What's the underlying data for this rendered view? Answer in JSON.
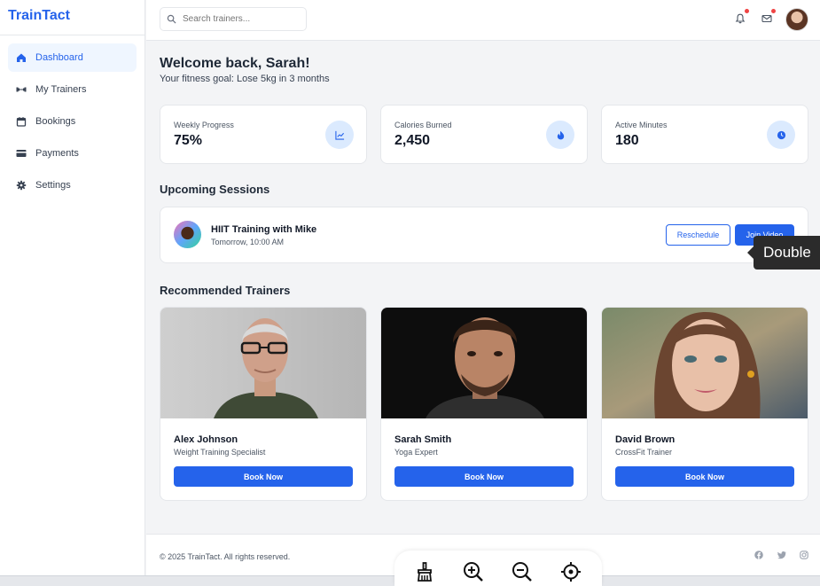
{
  "app": {
    "name": "TrainTact"
  },
  "sidebar": {
    "items": [
      {
        "label": "Dashboard",
        "icon": "home-icon",
        "active": true
      },
      {
        "label": "My Trainers",
        "icon": "dumbbell-icon",
        "active": false
      },
      {
        "label": "Bookings",
        "icon": "calendar-icon",
        "active": false
      },
      {
        "label": "Payments",
        "icon": "credit-card-icon",
        "active": false
      },
      {
        "label": "Settings",
        "icon": "gear-icon",
        "active": false
      }
    ]
  },
  "search": {
    "placeholder": "Search trainers..."
  },
  "header": {
    "welcome": "Welcome back, Sarah!",
    "goal": "Your fitness goal: Lose 5kg in 3 months"
  },
  "stats": [
    {
      "label": "Weekly Progress",
      "value": "75%",
      "icon": "chart-line-icon"
    },
    {
      "label": "Calories Burned",
      "value": "2,450",
      "icon": "fire-icon"
    },
    {
      "label": "Active Minutes",
      "value": "180",
      "icon": "clock-icon"
    }
  ],
  "sessions": {
    "title": "Upcoming Sessions",
    "items": [
      {
        "name": "HIIT Training with Mike",
        "time": "Tomorrow, 10:00 AM",
        "reschedule_label": "Reschedule",
        "join_label": "Join Video"
      }
    ]
  },
  "tooltip": {
    "text": "Double"
  },
  "trainers": {
    "title": "Recommended Trainers",
    "items": [
      {
        "name": "Alex Johnson",
        "role": "Weight Training Specialist",
        "button": "Book Now"
      },
      {
        "name": "Sarah Smith",
        "role": "Yoga Expert",
        "button": "Book Now"
      },
      {
        "name": "David Brown",
        "role": "CrossFit Trainer",
        "button": "Book Now"
      }
    ]
  },
  "footer": {
    "copyright": "© 2025 TrainTact. All rights reserved.",
    "social": [
      "facebook-icon",
      "twitter-icon",
      "instagram-icon"
    ]
  },
  "toolbar": {
    "tools": [
      "broom-icon",
      "zoom-in-icon",
      "zoom-out-icon",
      "crosshair-icon"
    ]
  },
  "colors": {
    "accent": "#2563eb",
    "accent_light": "#dbeafe",
    "notification": "#ef4444"
  }
}
